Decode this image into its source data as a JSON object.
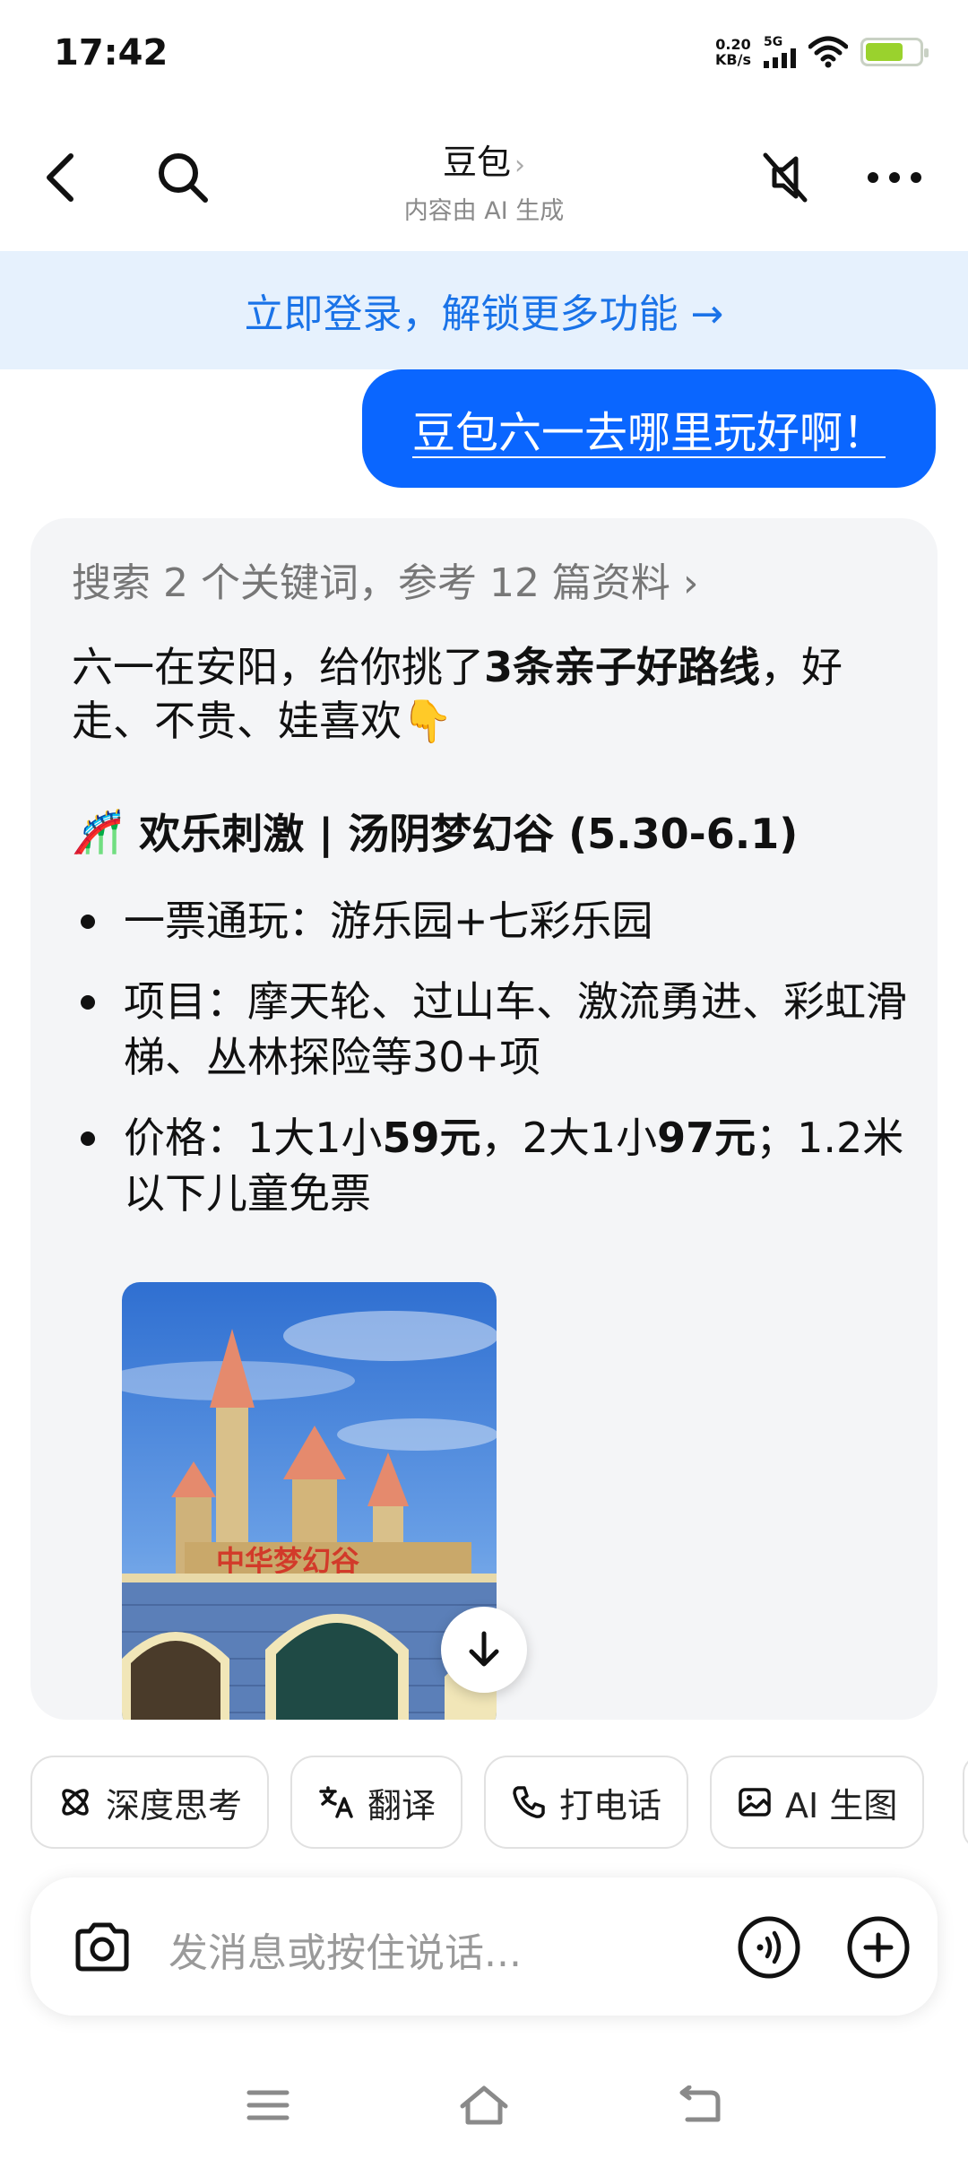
{
  "status_bar": {
    "time": "17:42",
    "net_speed_value": "0.20",
    "net_speed_unit": "KB/s",
    "signal_label": "5G",
    "battery_level": 0.7
  },
  "topnav": {
    "title": "豆包",
    "title_chevron": "›",
    "subtitle": "内容由 AI 生成",
    "icons": [
      "back-arrow-icon",
      "search-icon",
      "mute-icon",
      "more-icon"
    ]
  },
  "login_banner": {
    "text": "立即登录，解锁更多功能 →"
  },
  "user_message": {
    "text": "豆包六一去哪里玩好啊！"
  },
  "answer": {
    "search_ref": "搜索 2 个关键词，参考 12 篇资料 ›",
    "intro_pre": "六一在安阳，给你挑了",
    "intro_bold": "3条亲子好路线",
    "intro_post": "，好走、不贵、娃喜欢👇",
    "section_emoji": "🎢",
    "section_title": "欢乐刺激 | 汤阴梦幻谷 (5.30-6.1)",
    "bullet_1": "一票通玩：游乐园+七彩乐园",
    "bullet_2": "项目：摩天轮、过山车、激流勇进、彩虹滑梯、丛林探险等30+项",
    "bullet_3_a": "价格：1大1小",
    "bullet_3_b": "59元",
    "bullet_3_c": "，2大1小",
    "bullet_3_d": "97元",
    "bullet_3_e": "；1.2米以下儿童免票",
    "photo_sign": "中华梦幻谷"
  },
  "chips": [
    {
      "label": "深度思考",
      "icon": "atom-icon"
    },
    {
      "label": "翻译",
      "icon": "translate-icon"
    },
    {
      "label": "打电话",
      "icon": "phone-icon"
    },
    {
      "label": "AI 生图",
      "icon": "image-icon"
    }
  ],
  "input": {
    "placeholder": "发消息或按住说话..."
  },
  "colors": {
    "accent_blue": "#0a66ff",
    "banner_bg": "#e6f1fd",
    "banner_text": "#1a73e8",
    "card_bg": "#f4f5f7"
  }
}
